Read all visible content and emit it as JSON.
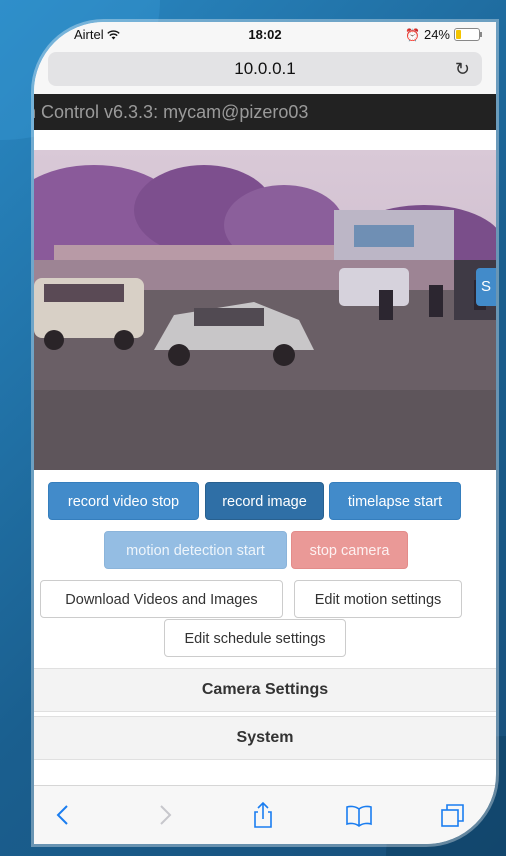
{
  "status_bar": {
    "carrier": "Airtel",
    "time": "18:02",
    "battery": "24%",
    "battery_level": 0.24
  },
  "browser": {
    "url": "10.0.0.1"
  },
  "app": {
    "header_title": "n Control v6.3.3: mycam@pizero03",
    "preview_side_button": "S"
  },
  "buttons": {
    "record_video_stop": "record video stop",
    "record_image": "record image",
    "timelapse_start": "timelapse start",
    "motion_detection_start": "motion detection start",
    "stop_camera": "stop camera",
    "download_media": "Download Videos and Images",
    "edit_motion_settings": "Edit motion settings",
    "edit_schedule_settings": "Edit schedule settings"
  },
  "sections": {
    "camera_settings": "Camera Settings",
    "system": "System"
  },
  "icons": {
    "toolbar": [
      "back-icon",
      "forward-icon",
      "share-icon",
      "bookmarks-icon",
      "tabs-icon"
    ]
  },
  "colors": {
    "primary": "#428bca",
    "primary_dark": "#2f6fa6",
    "header_bg": "#222222",
    "ios_blue": "#1a7df0"
  }
}
